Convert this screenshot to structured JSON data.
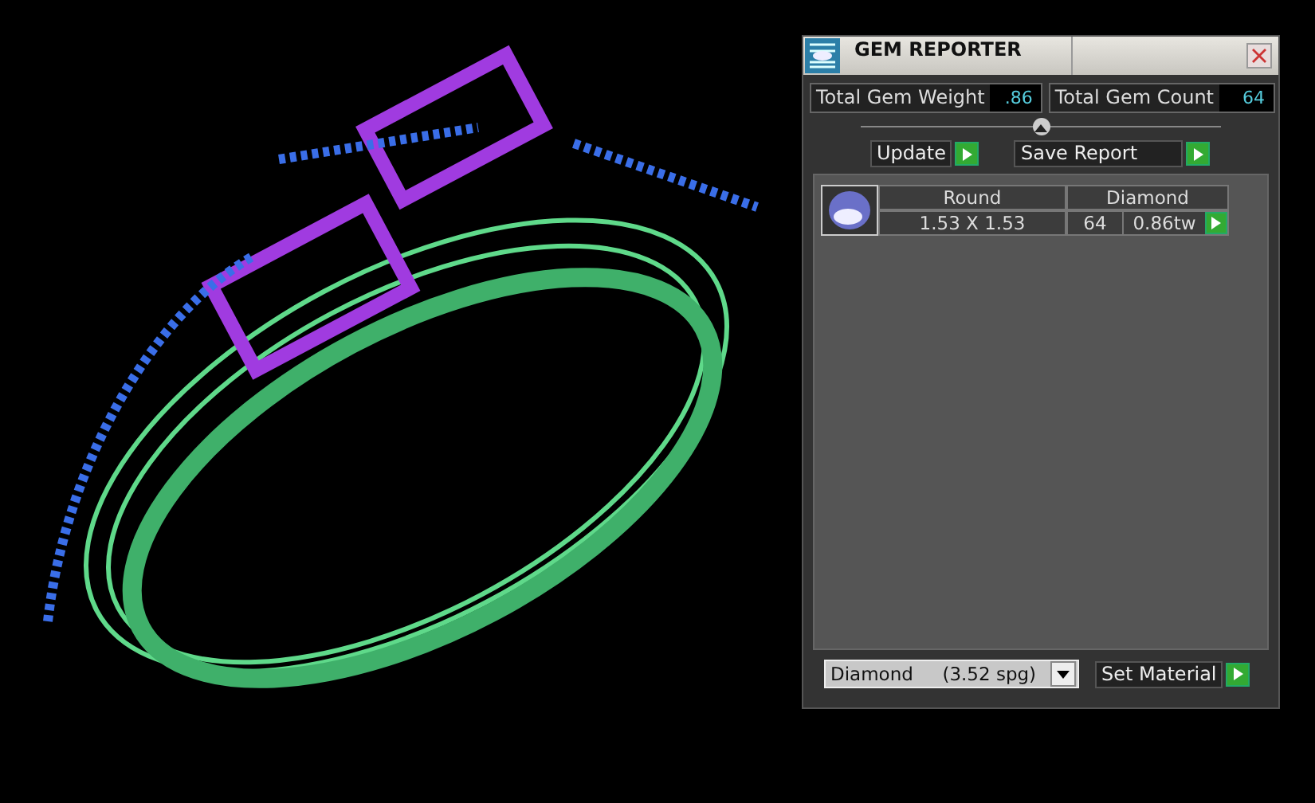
{
  "panel": {
    "title": "GEM REPORTER",
    "totals": [
      {
        "label": "Total Gem Weight",
        "value": ".86"
      },
      {
        "label": "Total Gem Count",
        "value": "64"
      }
    ],
    "actions": [
      "Update",
      "Save Report"
    ],
    "gems": [
      {
        "shape": "Round",
        "size": "1.53 X 1.53",
        "material": "Diamond",
        "count": "64",
        "weight": "0.86tw"
      }
    ],
    "material_select": {
      "value": "Diamond     (3.52 spg)"
    },
    "set_button": "Set Material"
  }
}
